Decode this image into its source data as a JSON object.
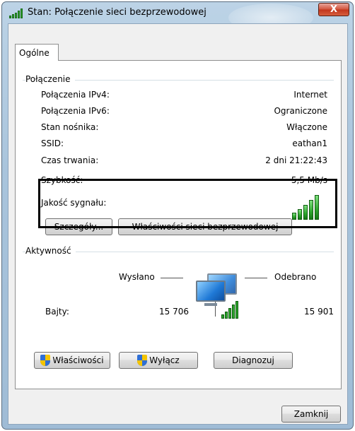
{
  "window": {
    "title": "Stan: Połączenie sieci bezprzewodowej",
    "close_glyph": "X",
    "title_icon": "wireless-signal-icon"
  },
  "tabs": [
    {
      "label": "Ogólne",
      "selected": true
    }
  ],
  "connection": {
    "group_label": "Połączenie",
    "rows": [
      {
        "label": "Połączenia IPv4:",
        "value": "Internet"
      },
      {
        "label": "Połączenia IPv6:",
        "value": "Ograniczone"
      },
      {
        "label": "Stan nośnika:",
        "value": "Włączone"
      },
      {
        "label": "SSID:",
        "value": "eathan1"
      },
      {
        "label": "Czas trwania:",
        "value": "2 dni 21:22:43"
      },
      {
        "label": "Szybkość:",
        "value": "5,5 Mb/s"
      }
    ],
    "signal_quality_label": "Jakość sygnału:",
    "signal_quality_bars": 5,
    "signal_quality_bars_total": 5,
    "details_button": "Szczegóły...",
    "wireless_props_button": "Właściwości sieci bezprzewodowej"
  },
  "activity": {
    "group_label": "Aktywność",
    "sent_label": "Wysłano",
    "received_label": "Odebrano",
    "bytes_label": "Bajty:",
    "bytes_sent": "15 706",
    "bytes_received": "15 901",
    "network_icon": "network-computers-icon"
  },
  "buttons": {
    "properties": "Właściwości",
    "disable": "Wyłącz",
    "diagnose": "Diagnozuj",
    "close": "Zamknij"
  },
  "colors": {
    "signal_green": "#2ea62e",
    "close_red": "#c2361c",
    "title_bar": "#a9c4dc",
    "highlight_border": "#000000"
  }
}
